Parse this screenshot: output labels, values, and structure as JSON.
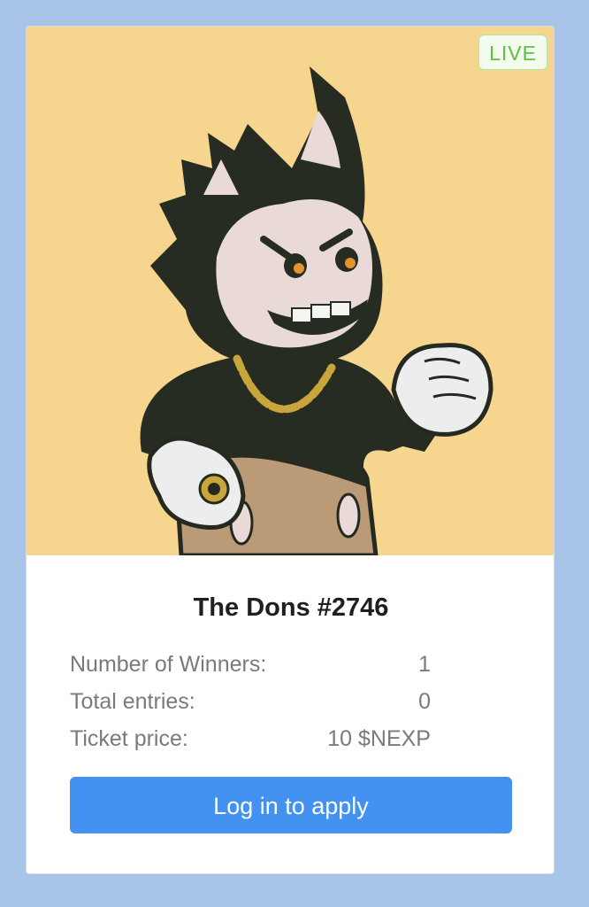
{
  "card": {
    "badge": "LIVE",
    "title": "The Dons #2746",
    "image": {
      "subject": "cartoon cat character with gold chain and ring",
      "background_color": "#f6d58e"
    },
    "stats": [
      {
        "label": "Number of Winners:",
        "value": "1"
      },
      {
        "label": "Total entries:",
        "value": "0"
      },
      {
        "label": "Ticket price:",
        "value": "10 $NEXP"
      }
    ],
    "button_label": "Log in to apply"
  },
  "colors": {
    "page_background": "#a8c4e8",
    "badge_text": "#5fbf3f",
    "button": "#4391f1"
  }
}
